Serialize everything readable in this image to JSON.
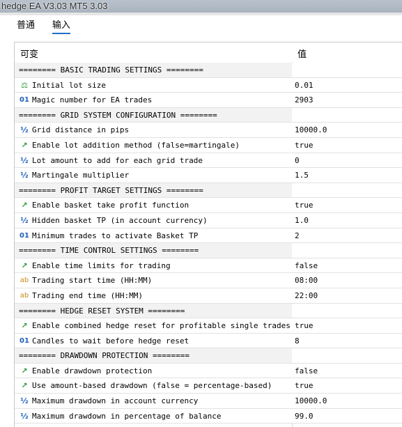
{
  "window": {
    "title": "hedge EA V3.03 MT5 3.03"
  },
  "tabs": [
    {
      "label": "普通"
    },
    {
      "label": "输入"
    }
  ],
  "table": {
    "header": {
      "name": "可变",
      "value": "值"
    },
    "rows": [
      {
        "type": "sep",
        "name": "======== BASIC TRADING SETTINGS ========"
      },
      {
        "type": "item",
        "icon": "lot-icon",
        "glyph": "⚖",
        "cls": "i-lot",
        "name": "Initial lot size",
        "value": "0.01"
      },
      {
        "type": "item",
        "icon": "integer-icon",
        "glyph": "01",
        "cls": "i-01",
        "name": "Magic number for EA trades",
        "value": "2903"
      },
      {
        "type": "sep",
        "name": "======== GRID SYSTEM CONFIGURATION ========"
      },
      {
        "type": "item",
        "icon": "fraction-icon",
        "glyph": "½",
        "cls": "i-half",
        "name": "Grid distance in pips",
        "value": "10000.0"
      },
      {
        "type": "item",
        "icon": "bool-icon",
        "glyph": "↗",
        "cls": "i-bool",
        "name": "Enable lot addition method (false=martingale)",
        "value": "true"
      },
      {
        "type": "item",
        "icon": "fraction-icon",
        "glyph": "½",
        "cls": "i-half",
        "name": "Lot amount to add for each grid trade",
        "value": "0"
      },
      {
        "type": "item",
        "icon": "fraction-icon",
        "glyph": "½",
        "cls": "i-half",
        "name": "Martingale multiplier",
        "value": "1.5"
      },
      {
        "type": "sep",
        "name": "======== PROFIT TARGET SETTINGS ========"
      },
      {
        "type": "item",
        "icon": "bool-icon",
        "glyph": "↗",
        "cls": "i-bool",
        "name": "Enable basket take profit function",
        "value": "true"
      },
      {
        "type": "item",
        "icon": "fraction-icon",
        "glyph": "½",
        "cls": "i-half",
        "name": "Hidden basket TP  (in account currency)",
        "value": "1.0"
      },
      {
        "type": "item",
        "icon": "integer-icon",
        "glyph": "01",
        "cls": "i-01",
        "name": "Minimum trades to activate Basket TP",
        "value": "2"
      },
      {
        "type": "sep",
        "name": "======== TIME CONTROL SETTINGS ========"
      },
      {
        "type": "item",
        "icon": "bool-icon",
        "glyph": "↗",
        "cls": "i-bool",
        "name": "Enable time limits for trading",
        "value": "false"
      },
      {
        "type": "item",
        "icon": "string-icon",
        "glyph": "ab",
        "cls": "i-ab",
        "name": "Trading start time (HH:MM)",
        "value": "08:00"
      },
      {
        "type": "item",
        "icon": "string-icon",
        "glyph": "ab",
        "cls": "i-ab",
        "name": "Trading end time (HH:MM)",
        "value": "22:00"
      },
      {
        "type": "sep",
        "name": "======== HEDGE RESET SYSTEM ========"
      },
      {
        "type": "item",
        "icon": "bool-icon",
        "glyph": "↗",
        "cls": "i-bool",
        "name": "Enable combined hedge reset for profitable single trades",
        "value": "true"
      },
      {
        "type": "item",
        "icon": "integer-icon",
        "glyph": "01",
        "cls": "i-01",
        "name": "Candles to wait before hedge reset",
        "value": "8"
      },
      {
        "type": "sep",
        "name": "======== DRAWDOWN PROTECTION ========"
      },
      {
        "type": "item",
        "icon": "bool-icon",
        "glyph": "↗",
        "cls": "i-bool",
        "name": "Enable drawdown protection",
        "value": "false"
      },
      {
        "type": "item",
        "icon": "bool-icon",
        "glyph": "↗",
        "cls": "i-bool",
        "name": "Use amount-based drawdown (false = percentage-based)",
        "value": "true"
      },
      {
        "type": "item",
        "icon": "fraction-icon",
        "glyph": "½",
        "cls": "i-half",
        "name": "Maximum drawdown in account currency",
        "value": "10000.0"
      },
      {
        "type": "item",
        "icon": "fraction-icon",
        "glyph": "½",
        "cls": "i-half",
        "name": "Maximum drawdown in percentage of balance",
        "value": "99.0"
      }
    ]
  }
}
